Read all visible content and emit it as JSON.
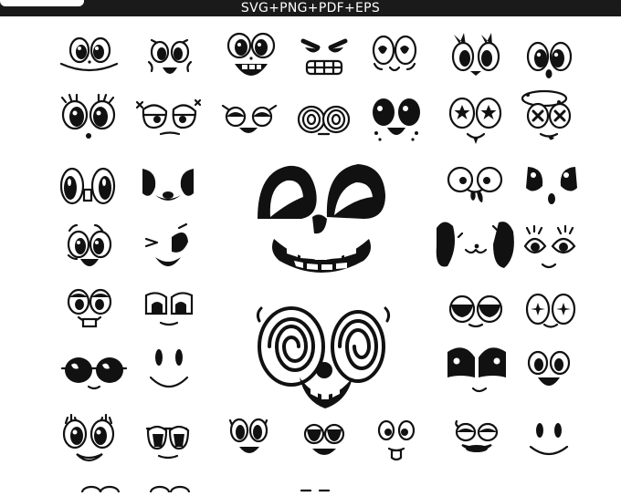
{
  "banner": {
    "formats_label": "SVG+PNG+PDF+EPS",
    "background_color": "#1a1a1a",
    "text_color": "#ffffff"
  },
  "artwork": {
    "ink_color": "#111111",
    "paper_color": "#ffffff"
  }
}
